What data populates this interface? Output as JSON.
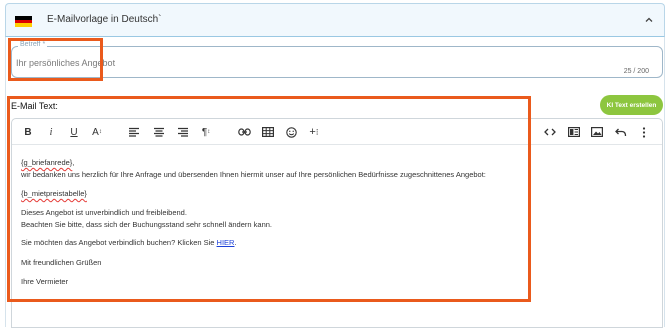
{
  "accordion": {
    "title": "E-Mailvorlage in Deutsch`",
    "flag_colors": [
      "#000000",
      "#dd0000",
      "#ffce00"
    ]
  },
  "subject": {
    "label": "Betreff *",
    "value": "Ihr persönliches Angebot",
    "counter": "25 / 200"
  },
  "email": {
    "label": "E-Mail Text:",
    "ai_button_label": "KI Text erstellen"
  },
  "toolbar": {
    "left": [
      "bold-icon",
      "italic-icon",
      "underline-icon",
      "font-size-icon",
      "align-left-icon",
      "align-center-icon",
      "align-right-icon",
      "paragraph-icon",
      "link-icon",
      "table-icon",
      "emoji-icon",
      "insert-icon"
    ],
    "right": [
      "code-view-icon",
      "template-icon",
      "image-icon",
      "undo-icon",
      "more-icon"
    ]
  },
  "body": {
    "line1_token": "{g_briefanrede}",
    "line1_after": ",",
    "line2": "wir bedanken uns herzlich für Ihre Anfrage und übersenden Ihnen hiermit unser auf Ihre persönlichen Bedürfnisse zugeschnittenes Angebot:",
    "line3_token": "{b_mietpreistabelle}",
    "line4": "Dieses Angebot ist unverbindlich und freibleibend.",
    "line5": "Beachten Sie bitte, dass sich der Buchungsstand sehr schnell ändern kann.",
    "line6_before": "Sie möchten das Angebot verbindlich buchen? Klicken Sie ",
    "line6_link": "HIER",
    "line6_after": ".",
    "line7": "Mit freundlichen Grüßen",
    "line8": "Ihre Vermieter"
  },
  "colors": {
    "highlight": "#ea5a1c",
    "ai_button": "#8dc63f",
    "link": "#1a3fd8"
  }
}
